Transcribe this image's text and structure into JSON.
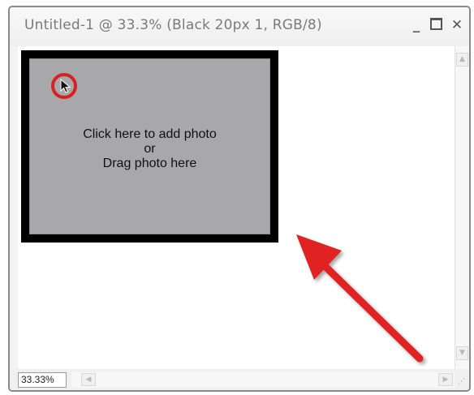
{
  "window": {
    "title": "Untitled-1 @ 33.3% (Black 20px 1, RGB/8)",
    "minimize_label": "_",
    "close_label": "✕"
  },
  "canvas": {
    "placeholder_lines": [
      "Click here to add photo",
      "or",
      "Drag photo here"
    ],
    "annotation_color": "#d42323"
  },
  "statusbar": {
    "zoom_value": "33.33%"
  },
  "icons": {
    "cursor": "mouse-pointer-icon",
    "annotation_arrow": "red-arrow-icon",
    "annotation_circle": "red-circle-highlight"
  }
}
